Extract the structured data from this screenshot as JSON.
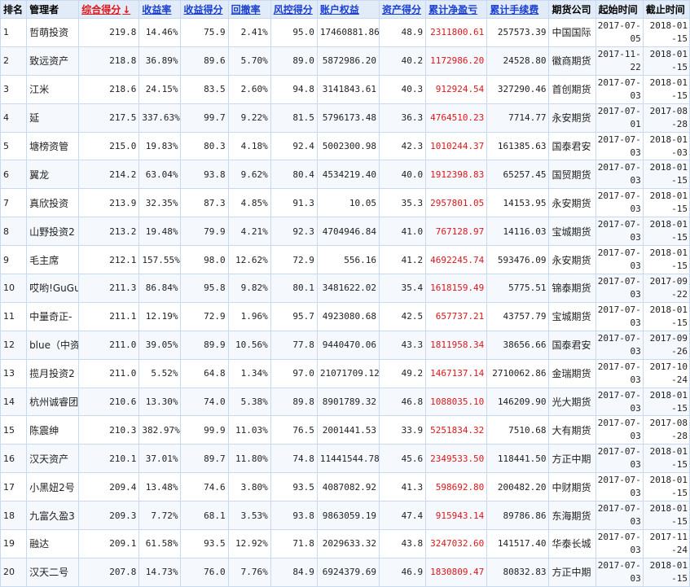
{
  "headers": {
    "rank": "排名",
    "manager": "管理者",
    "composite": "综合得分",
    "sort_arrow": "↓",
    "return_rate": "收益率",
    "return_score": "收益得分",
    "drawdown": "回撤率",
    "risk_score": "风控得分",
    "equity": "账户权益",
    "asset_score": "资产得分",
    "cum_profit": "累计净盈亏",
    "cum_fee": "累计手续费",
    "futures_co": "期货公司",
    "start": "起始时间",
    "end": "截止时间"
  },
  "colors": {
    "header_bg": "#e2ecf8",
    "link_blue": "#1a3fd0",
    "profit_red": "#e0161a",
    "border": "#c9daf0"
  },
  "rows": [
    {
      "rank": "1",
      "manager": "哲萌投资",
      "composite": "219.8",
      "return_rate": "14.46%",
      "return_score": "75.9",
      "drawdown": "2.41%",
      "risk_score": "95.0",
      "equity": "17460881.86",
      "asset_score": "48.9",
      "cum_profit": "2311800.61",
      "cum_fee": "257573.39",
      "futures_co": "中国国际",
      "start": "2017-07-05",
      "end": "2018-01-15"
    },
    {
      "rank": "2",
      "manager": "致远资产",
      "composite": "218.8",
      "return_rate": "36.89%",
      "return_score": "89.6",
      "drawdown": "5.70%",
      "risk_score": "89.0",
      "equity": "5872986.20",
      "asset_score": "40.2",
      "cum_profit": "1172986.20",
      "cum_fee": "24528.80",
      "futures_co": "徽商期货",
      "start": "2017-11-22",
      "end": "2018-01-15"
    },
    {
      "rank": "3",
      "manager": "江米",
      "composite": "218.6",
      "return_rate": "24.15%",
      "return_score": "83.5",
      "drawdown": "2.60%",
      "risk_score": "94.8",
      "equity": "3141843.61",
      "asset_score": "40.3",
      "cum_profit": "912924.54",
      "cum_fee": "327290.46",
      "futures_co": "首创期货",
      "start": "2017-07-03",
      "end": "2018-01-15"
    },
    {
      "rank": "4",
      "manager": "延",
      "composite": "217.5",
      "return_rate": "337.63%",
      "return_score": "99.7",
      "drawdown": "9.22%",
      "risk_score": "81.5",
      "equity": "5796173.48",
      "asset_score": "36.3",
      "cum_profit": "4764510.23",
      "cum_fee": "7714.77",
      "futures_co": "永安期货",
      "start": "2017-07-01",
      "end": "2017-08-28"
    },
    {
      "rank": "5",
      "manager": "塘榜资管",
      "composite": "215.0",
      "return_rate": "19.83%",
      "return_score": "80.3",
      "drawdown": "4.18%",
      "risk_score": "92.4",
      "equity": "5002300.98",
      "asset_score": "42.3",
      "cum_profit": "1010244.37",
      "cum_fee": "161385.63",
      "futures_co": "国泰君安",
      "start": "2017-07-03",
      "end": "2018-01-03"
    },
    {
      "rank": "6",
      "manager": "翼龙",
      "composite": "214.2",
      "return_rate": "63.04%",
      "return_score": "93.8",
      "drawdown": "9.62%",
      "risk_score": "80.4",
      "equity": "4534219.40",
      "asset_score": "40.0",
      "cum_profit": "1912398.83",
      "cum_fee": "65257.45",
      "futures_co": "国贸期货",
      "start": "2017-07-03",
      "end": "2018-01-15"
    },
    {
      "rank": "7",
      "manager": "真欣投资",
      "composite": "213.9",
      "return_rate": "32.35%",
      "return_score": "87.3",
      "drawdown": "4.85%",
      "risk_score": "91.3",
      "equity": "10.05",
      "asset_score": "35.3",
      "cum_profit": "2957801.05",
      "cum_fee": "14153.95",
      "futures_co": "永安期货",
      "start": "2017-07-03",
      "end": "2018-01-15"
    },
    {
      "rank": "8",
      "manager": "山野投资2",
      "composite": "213.2",
      "return_rate": "19.48%",
      "return_score": "79.9",
      "drawdown": "4.21%",
      "risk_score": "92.3",
      "equity": "4704946.84",
      "asset_score": "41.0",
      "cum_profit": "767128.97",
      "cum_fee": "14116.03",
      "futures_co": "宝城期货",
      "start": "2017-07-03",
      "end": "2018-01-15"
    },
    {
      "rank": "9",
      "manager": "毛主席",
      "composite": "212.1",
      "return_rate": "157.55%",
      "return_score": "98.0",
      "drawdown": "12.62%",
      "risk_score": "72.9",
      "equity": "556.16",
      "asset_score": "41.2",
      "cum_profit": "4692245.74",
      "cum_fee": "593476.09",
      "futures_co": "永安期货",
      "start": "2017-07-03",
      "end": "2018-01-15"
    },
    {
      "rank": "10",
      "manager": "哎哟!GuGu",
      "composite": "211.3",
      "return_rate": "86.84%",
      "return_score": "95.8",
      "drawdown": "9.82%",
      "risk_score": "80.1",
      "equity": "3481622.02",
      "asset_score": "35.4",
      "cum_profit": "1618159.49",
      "cum_fee": "5775.51",
      "futures_co": "锦泰期货",
      "start": "2017-07-03",
      "end": "2017-09-22"
    },
    {
      "rank": "11",
      "manager": "中量奇正-",
      "composite": "211.1",
      "return_rate": "12.19%",
      "return_score": "72.9",
      "drawdown": "1.96%",
      "risk_score": "95.7",
      "equity": "4923080.68",
      "asset_score": "42.5",
      "cum_profit": "657737.21",
      "cum_fee": "43757.79",
      "futures_co": "宝城期货",
      "start": "2017-07-03",
      "end": "2018-01-15"
    },
    {
      "rank": "12",
      "manager": "blue（中资",
      "composite": "211.0",
      "return_rate": "39.05%",
      "return_score": "89.9",
      "drawdown": "10.56%",
      "risk_score": "77.8",
      "equity": "9440470.06",
      "asset_score": "43.3",
      "cum_profit": "1811958.34",
      "cum_fee": "38656.66",
      "futures_co": "国泰君安",
      "start": "2017-07-03",
      "end": "2017-09-26"
    },
    {
      "rank": "13",
      "manager": "揽月投资2",
      "composite": "211.0",
      "return_rate": "5.52%",
      "return_score": "64.8",
      "drawdown": "1.34%",
      "risk_score": "97.0",
      "equity": "21071709.12",
      "asset_score": "49.2",
      "cum_profit": "1467137.14",
      "cum_fee": "2710062.86",
      "futures_co": "金瑞期货",
      "start": "2017-07-03",
      "end": "2017-10-24"
    },
    {
      "rank": "14",
      "manager": "杭州诚睿团",
      "composite": "210.6",
      "return_rate": "13.30%",
      "return_score": "74.0",
      "drawdown": "5.38%",
      "risk_score": "89.8",
      "equity": "8901789.32",
      "asset_score": "46.8",
      "cum_profit": "1088035.10",
      "cum_fee": "146209.90",
      "futures_co": "光大期货",
      "start": "2017-07-03",
      "end": "2018-01-15"
    },
    {
      "rank": "15",
      "manager": "陈震绅",
      "composite": "210.3",
      "return_rate": "382.97%",
      "return_score": "99.9",
      "drawdown": "11.03%",
      "risk_score": "76.5",
      "equity": "2001441.53",
      "asset_score": "33.9",
      "cum_profit": "5251834.32",
      "cum_fee": "7510.68",
      "futures_co": "大有期货",
      "start": "2017-07-03",
      "end": "2017-08-28"
    },
    {
      "rank": "16",
      "manager": "汉天资产",
      "composite": "210.1",
      "return_rate": "37.01%",
      "return_score": "89.7",
      "drawdown": "11.80%",
      "risk_score": "74.8",
      "equity": "11441544.78",
      "asset_score": "45.6",
      "cum_profit": "2349533.50",
      "cum_fee": "118441.50",
      "futures_co": "方正中期",
      "start": "2017-07-03",
      "end": "2018-01-15"
    },
    {
      "rank": "17",
      "manager": "小黑妞2号",
      "composite": "209.4",
      "return_rate": "13.48%",
      "return_score": "74.6",
      "drawdown": "3.80%",
      "risk_score": "93.5",
      "equity": "4087082.92",
      "asset_score": "41.3",
      "cum_profit": "598692.80",
      "cum_fee": "200482.20",
      "futures_co": "中财期货",
      "start": "2017-07-03",
      "end": "2018-01-15"
    },
    {
      "rank": "18",
      "manager": "九富久盈3",
      "composite": "209.3",
      "return_rate": "7.72%",
      "return_score": "68.1",
      "drawdown": "3.53%",
      "risk_score": "93.8",
      "equity": "9863059.19",
      "asset_score": "47.4",
      "cum_profit": "915943.14",
      "cum_fee": "89786.86",
      "futures_co": "东海期货",
      "start": "2017-07-03",
      "end": "2018-01-15"
    },
    {
      "rank": "19",
      "manager": "融达",
      "composite": "209.1",
      "return_rate": "61.58%",
      "return_score": "93.5",
      "drawdown": "12.92%",
      "risk_score": "71.8",
      "equity": "2029633.32",
      "asset_score": "43.8",
      "cum_profit": "3247032.60",
      "cum_fee": "141517.40",
      "futures_co": "华泰长城",
      "start": "2017-07-03",
      "end": "2017-11-24"
    },
    {
      "rank": "20",
      "manager": "汉天二号",
      "composite": "207.8",
      "return_rate": "14.73%",
      "return_score": "76.0",
      "drawdown": "7.76%",
      "risk_score": "84.9",
      "equity": "6924379.69",
      "asset_score": "46.9",
      "cum_profit": "1830809.47",
      "cum_fee": "80832.83",
      "futures_co": "方正中期",
      "start": "2017-07-03",
      "end": "2018-01-15"
    }
  ]
}
